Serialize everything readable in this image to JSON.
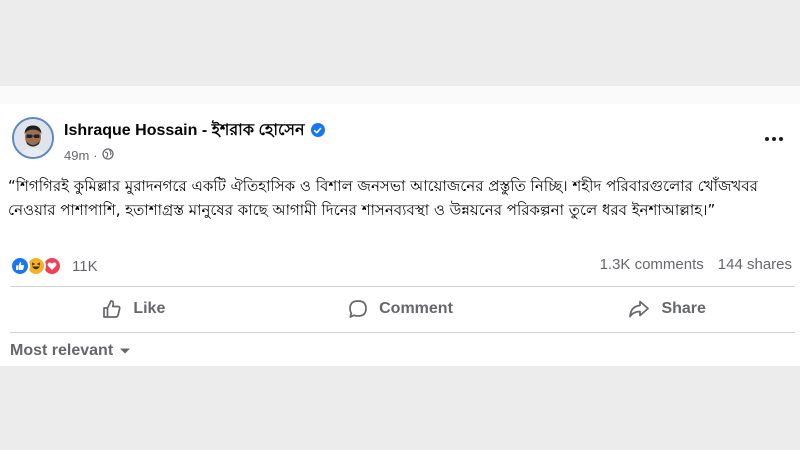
{
  "post": {
    "author": "Ishraque Hossain - ইশরাক হোসেন",
    "time": "49m",
    "privacy_icon": "globe-icon",
    "text": "“শিগগিরই কুমিল্লার মুরাদনগরে একটি ঐতিহাসিক ও বিশাল জনসভা আয়োজনের প্রস্তুতি নিচ্ছি। শহীদ পরিবারগুলোর খোঁজখবর নেওয়ার পাশাপাশি, হতাশাগ্রস্ত মানুষের কাছে আগামী দিনের শাসনব্যবস্থা ও উন্নয়নের পরিকল্পনা তুলে ধরব ইনশাআল্লাহ।”",
    "verified": true
  },
  "reactions": {
    "types": [
      "like",
      "haha",
      "love"
    ],
    "count": "11K",
    "comments": "1.3K comments",
    "shares": "144 shares"
  },
  "actions": {
    "like": "Like",
    "comment": "Comment",
    "share": "Share"
  },
  "comments": {
    "sort_label": "Most relevant"
  },
  "colors": {
    "brand_blue": "#1877f2",
    "secondary_text": "#65676b",
    "haha_yellow": "#f7b125",
    "love_red": "#f33e58"
  }
}
